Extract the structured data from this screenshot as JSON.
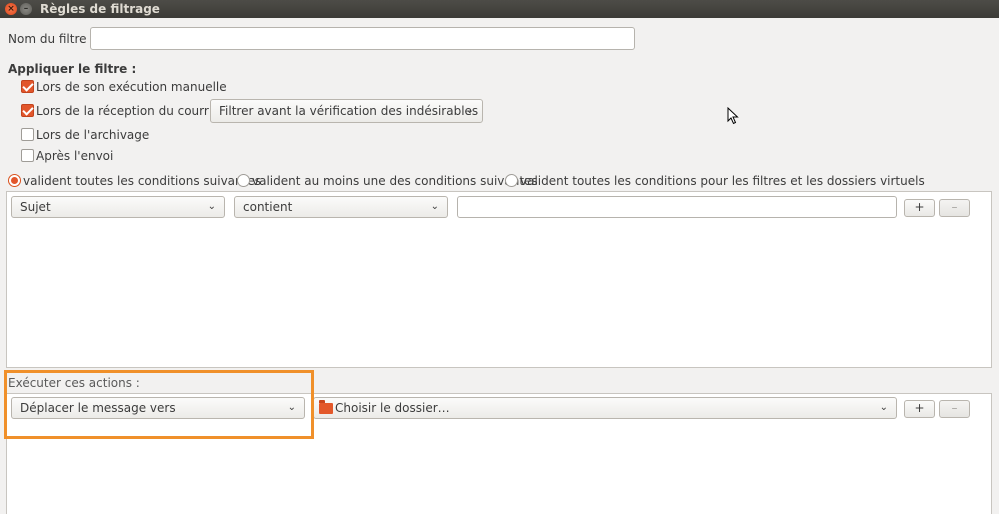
{
  "window": {
    "title": "Règles de filtrage",
    "close_glyph": "×",
    "minimize_glyph": "–"
  },
  "filter_name": {
    "label": "Nom du filtre :",
    "value": ""
  },
  "apply": {
    "heading": "Appliquer le filtre :",
    "options": [
      {
        "label": "Lors de son exécution manuelle",
        "checked": true
      },
      {
        "label": "Lors de la réception du courrier :",
        "checked": true
      },
      {
        "label": "Lors de l'archivage",
        "checked": false
      },
      {
        "label": "Après l'envoi",
        "checked": false
      }
    ],
    "reception_select": "Filtrer avant la vérification des indésirables"
  },
  "match": {
    "options": [
      {
        "label": "valident toutes les conditions suivantes",
        "selected": true
      },
      {
        "label": "valident au moins une des conditions suivantes",
        "selected": false
      },
      {
        "label": "valident toutes les conditions pour les filtres et les dossiers virtuels",
        "selected": false
      }
    ]
  },
  "condition": {
    "field": "Sujet",
    "operator": "contient",
    "value": "",
    "add_label": "+",
    "remove_label": "–"
  },
  "actions": {
    "heading": "Exécuter ces actions :",
    "action": "Déplacer le message vers",
    "folder": "Choisir le dossier…",
    "add_label": "+",
    "remove_label": "–"
  },
  "icons": {
    "dropdown": "chevron-down-icon",
    "folder": "folder-icon",
    "cursor": "mouse-cursor-icon"
  },
  "colors": {
    "accent": "#e2562b",
    "highlight": "#f0902a",
    "titlebar": "#3c3b37"
  }
}
